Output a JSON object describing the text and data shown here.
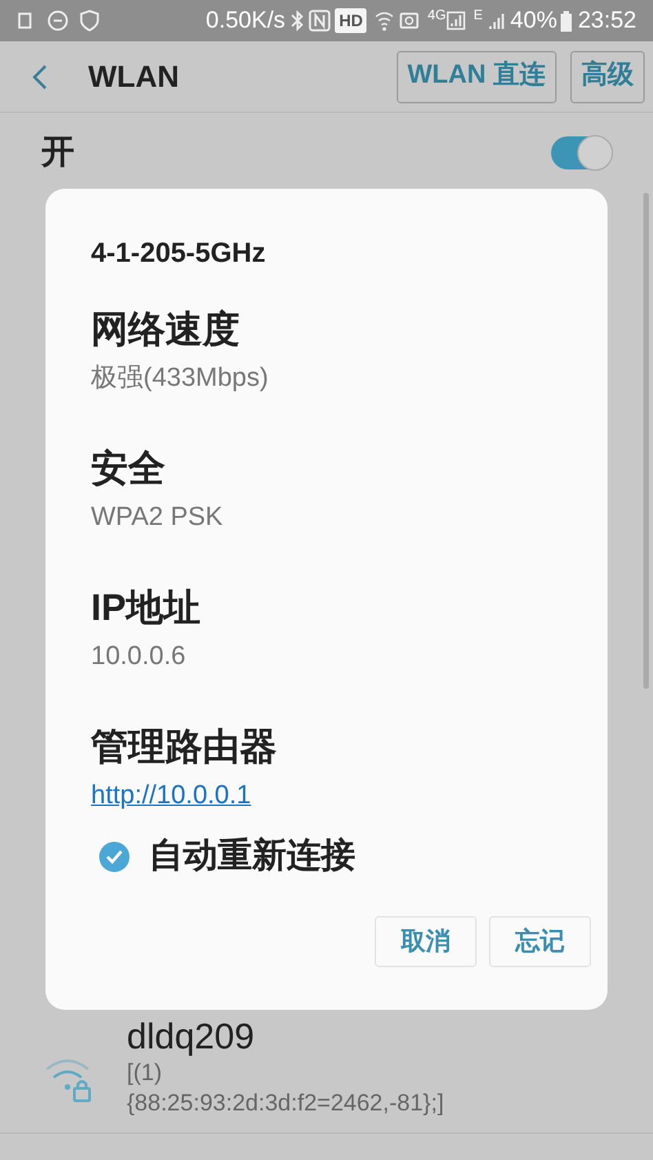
{
  "status_bar": {
    "speed": "0.50K/s",
    "hd": "HD",
    "net_4g": "4G",
    "net_e": "E",
    "battery": "40%",
    "time": "23:52"
  },
  "toolbar": {
    "title": "WLAN",
    "buttons": [
      "WLAN 直连",
      "高级"
    ]
  },
  "wlan_switch": {
    "label": "开",
    "on": true
  },
  "networks": [
    {
      "name": "dldq209",
      "detail": "[(1)\n{88:25:93:2d:3d:f2=2462,-81};]",
      "secured": true
    }
  ],
  "dialog": {
    "title": "4-1-205-5GHz",
    "fields": [
      {
        "kind": "text",
        "label": "网络速度",
        "value": "极强(433Mbps)"
      },
      {
        "kind": "text",
        "label": "安全",
        "value": "WPA2 PSK"
      },
      {
        "kind": "text",
        "label": "IP地址",
        "value": "10.0.0.6"
      },
      {
        "kind": "link",
        "label": "管理路由器",
        "value": "http://10.0.0.1"
      }
    ],
    "auto_reconnect": {
      "label": "自动重新连接",
      "checked": true
    },
    "buttons": [
      "取消",
      "忘记"
    ]
  }
}
